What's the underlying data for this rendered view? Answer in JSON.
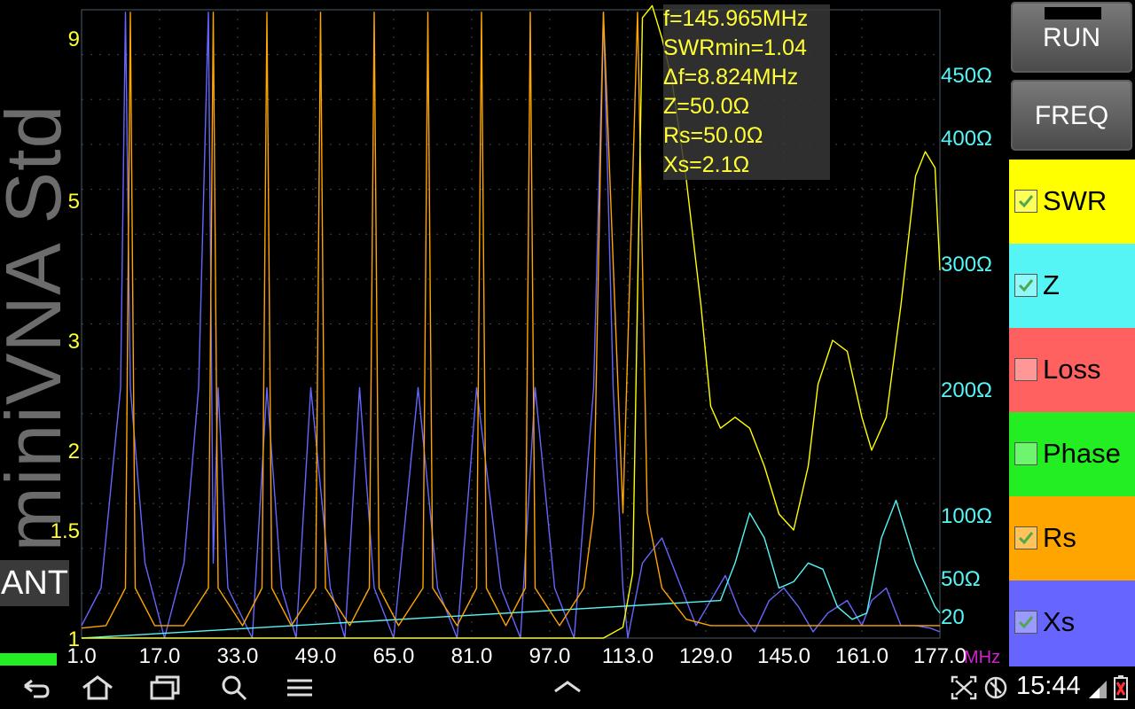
{
  "app": {
    "brand": "miniVNA Std",
    "mode_label": "ANT"
  },
  "info": {
    "lines": [
      "f=145.965MHz",
      "SWRmin=1.04",
      "Δf=8.824MHz",
      "Z=50.0Ω",
      "Rs=50.0Ω",
      "Xs=2.1Ω"
    ]
  },
  "buttons": {
    "run": "RUN",
    "freq": "FREQ"
  },
  "traces": [
    {
      "label": "SWR",
      "checked": true,
      "color": "#ffff00"
    },
    {
      "label": "Z",
      "checked": true,
      "color": "#55f5f5"
    },
    {
      "label": "Loss",
      "checked": false,
      "color": "#ff6060"
    },
    {
      "label": "Phase",
      "checked": false,
      "color": "#22ee22"
    },
    {
      "label": "Rs",
      "checked": true,
      "color": "#ffa500"
    },
    {
      "label": "Xs",
      "checked": true,
      "color": "#6666ff"
    }
  ],
  "status": {
    "time": "15:44"
  },
  "chart_data": {
    "type": "line",
    "xlabel": "MHz",
    "xlim": [
      1.0,
      177.0
    ],
    "x_ticks": [
      "1.0",
      "17.0",
      "33.0",
      "49.0",
      "65.0",
      "81.0",
      "97.0",
      "113.0",
      "129.0",
      "145.0",
      "161.0",
      "177.0"
    ],
    "y_left_label": "SWR",
    "y_left_ticks": [
      {
        "value": 9,
        "label": "9"
      },
      {
        "value": 5,
        "label": "5"
      },
      {
        "value": 3,
        "label": "3"
      },
      {
        "value": 2,
        "label": "2"
      },
      {
        "value": 1.5,
        "label": "1.5"
      },
      {
        "value": 1,
        "label": "1"
      }
    ],
    "y_right_ticks": [
      {
        "value": 450,
        "label": "450Ω"
      },
      {
        "value": 400,
        "label": "400Ω"
      },
      {
        "value": 300,
        "label": "300Ω"
      },
      {
        "value": 200,
        "label": "200Ω"
      },
      {
        "value": 100,
        "label": "100Ω"
      },
      {
        "value": 50,
        "label": "50Ω"
      },
      {
        "value": 20,
        "label": "20"
      }
    ],
    "series": [
      {
        "name": "SWR",
        "color": "#ffff00",
        "axis": "left",
        "x": [
          1,
          5,
          8,
          10,
          12,
          16,
          20,
          24,
          28,
          32,
          36,
          40,
          44,
          48,
          52,
          56,
          62,
          66,
          70,
          74,
          78,
          82,
          86,
          90,
          96,
          100,
          104,
          108,
          112,
          114,
          116,
          118,
          120,
          122,
          125,
          128,
          130,
          132,
          135,
          138,
          141,
          144,
          147,
          150,
          152,
          155,
          158,
          161,
          163,
          166,
          169,
          172,
          174,
          176,
          177
        ],
        "y": [
          1.0,
          1.0,
          1.0,
          1.0,
          1.0,
          1.0,
          1.0,
          1.0,
          1.0,
          1.0,
          1.0,
          1.0,
          1.0,
          1.0,
          1.0,
          1.0,
          1.0,
          1.0,
          1.0,
          1.0,
          1.0,
          1.0,
          1.0,
          1.0,
          1.0,
          1.0,
          1.0,
          1.0,
          1.05,
          1.3,
          9.5,
          9.8,
          9.0,
          8.0,
          5.5,
          3.5,
          2.4,
          2.2,
          2.3,
          2.2,
          1.9,
          1.6,
          1.5,
          1.9,
          2.6,
          3.0,
          2.9,
          2.3,
          2.0,
          2.3,
          3.5,
          5.6,
          6.2,
          5.8,
          4.0
        ]
      },
      {
        "name": "Z",
        "color": "#55f5f5",
        "axis": "right",
        "x": [
          1,
          132,
          135,
          138,
          141,
          144,
          147,
          150,
          153,
          156,
          159,
          162,
          165,
          168,
          172,
          176,
          177
        ],
        "y": [
          0,
          30,
          60,
          100,
          80,
          40,
          45,
          60,
          55,
          25,
          15,
          20,
          80,
          110,
          60,
          25,
          20
        ]
      },
      {
        "name": "Rs",
        "color": "#ffa500",
        "axis": "right",
        "x": [
          1,
          6,
          10,
          11,
          12,
          16,
          22,
          27,
          28,
          29,
          34,
          38,
          39,
          40,
          44,
          49,
          50,
          51,
          56,
          60,
          61,
          62,
          66,
          71,
          72,
          73,
          78,
          82,
          83,
          84,
          88,
          92,
          93,
          94,
          99,
          104,
          106,
          108,
          112,
          115,
          117,
          120,
          125,
          130,
          177
        ],
        "y": [
          8,
          10,
          40,
          500,
          40,
          10,
          10,
          40,
          500,
          40,
          10,
          40,
          500,
          40,
          10,
          40,
          500,
          40,
          10,
          40,
          500,
          40,
          10,
          40,
          500,
          40,
          10,
          40,
          500,
          40,
          10,
          40,
          500,
          40,
          10,
          40,
          100,
          500,
          100,
          500,
          100,
          40,
          15,
          10,
          10
        ]
      },
      {
        "name": "Xs",
        "color": "#6666ff",
        "axis": "right",
        "x": [
          1,
          5,
          9,
          10,
          11,
          14,
          18,
          22,
          25,
          27,
          28,
          29,
          31,
          36,
          39,
          42,
          45,
          48,
          52,
          55,
          58,
          61,
          65,
          70,
          74,
          78,
          82,
          87,
          91,
          94,
          98,
          102,
          106,
          108,
          110,
          112,
          113,
          116,
          120,
          124,
          127,
          130,
          133,
          136,
          139,
          142,
          145,
          148,
          151,
          154,
          158,
          161,
          163,
          166,
          169,
          172,
          175,
          177
        ],
        "y": [
          10,
          40,
          200,
          500,
          200,
          60,
          0,
          60,
          200,
          500,
          60,
          200,
          40,
          0,
          200,
          40,
          0,
          200,
          40,
          0,
          200,
          40,
          0,
          200,
          40,
          0,
          200,
          40,
          0,
          200,
          40,
          0,
          200,
          500,
          200,
          40,
          0,
          60,
          80,
          40,
          10,
          30,
          50,
          20,
          5,
          30,
          40,
          25,
          5,
          20,
          30,
          10,
          30,
          40,
          10,
          10,
          8,
          5
        ]
      }
    ]
  }
}
